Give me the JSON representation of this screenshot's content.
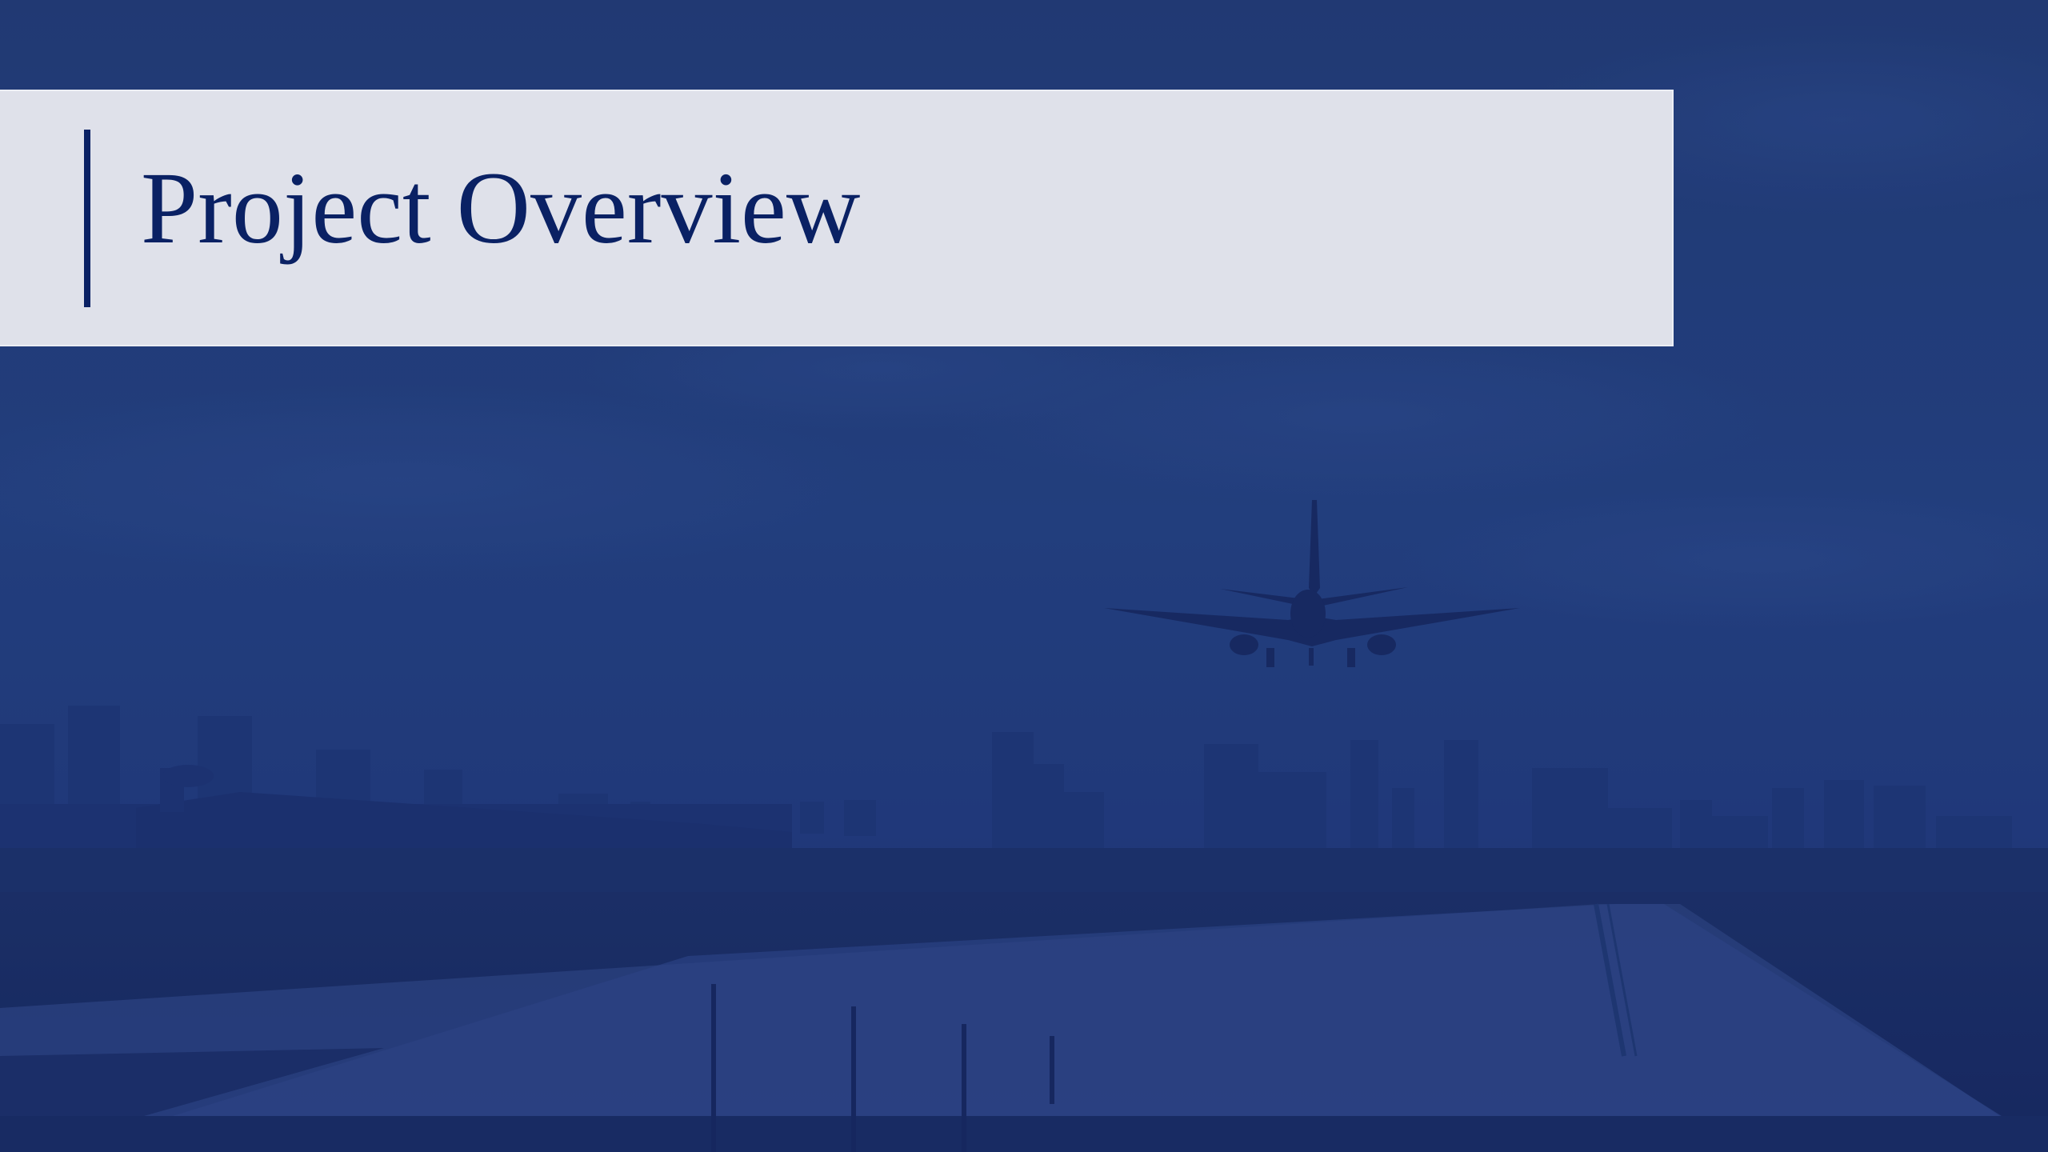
{
  "slide": {
    "title": "Project Overview"
  },
  "background": {
    "description_icon": "airplane-landing-photo",
    "overlay_color": "#1f3a7a"
  },
  "colors": {
    "title_text": "#0a2164",
    "accent_bar": "#0a2164",
    "banner": "#dfe1ea"
  }
}
